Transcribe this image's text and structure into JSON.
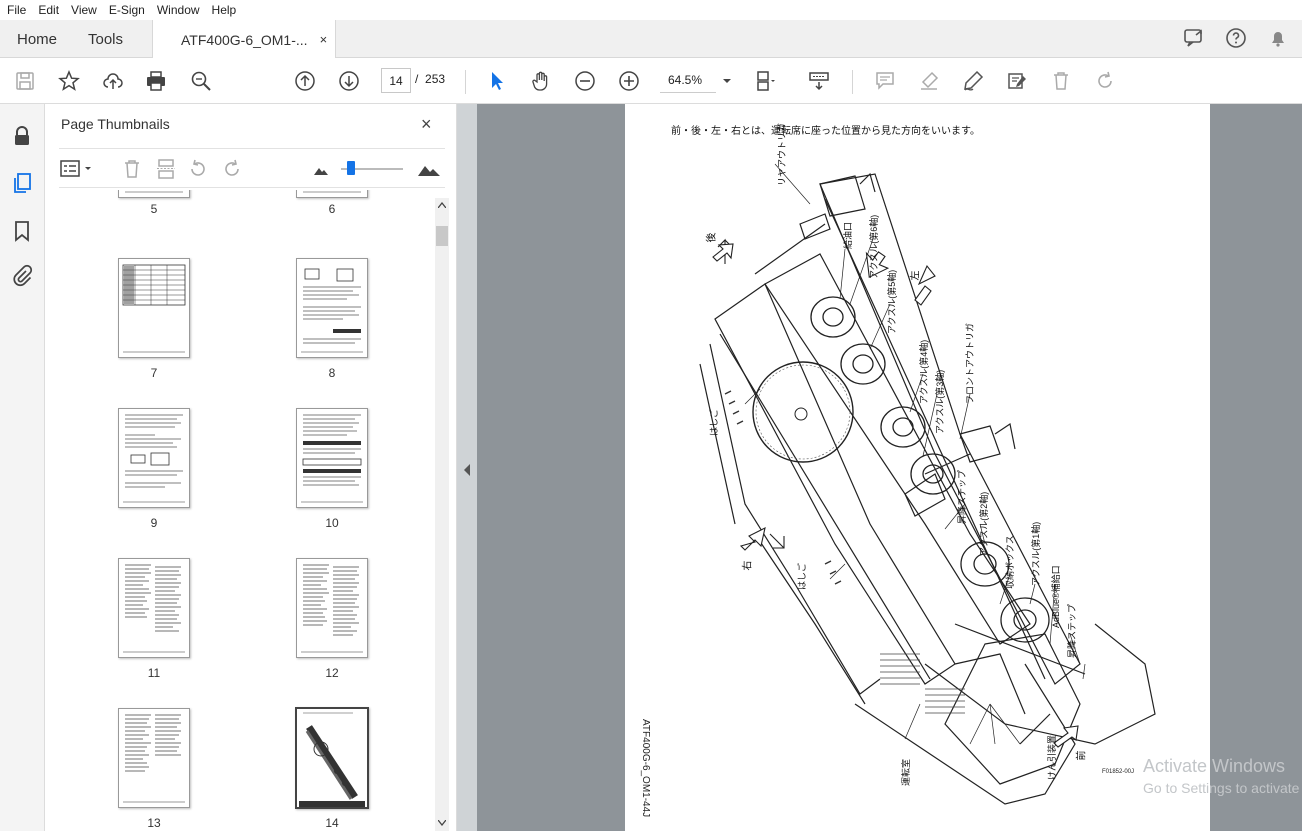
{
  "menu": [
    "File",
    "Edit",
    "View",
    "E-Sign",
    "Window",
    "Help"
  ],
  "tabs": {
    "home": "Home",
    "tools": "Tools",
    "document": "ATF400G-6_OM1-...",
    "close": "×"
  },
  "toolbar": {
    "current_page": "14",
    "page_sep": "/",
    "total_pages": "253",
    "zoom": "64.5%"
  },
  "panel": {
    "title": "Page Thumbnails",
    "close": "×"
  },
  "thumbnails": [
    {
      "label": "5"
    },
    {
      "label": "6"
    },
    {
      "label": "7"
    },
    {
      "label": "8"
    },
    {
      "label": "9"
    },
    {
      "label": "10"
    },
    {
      "label": "11"
    },
    {
      "label": "12"
    },
    {
      "label": "13"
    },
    {
      "label": "14",
      "selected": true
    }
  ],
  "document_page": {
    "header": "前・後・左・右とは、運転席に座った位置から見た方向をいいます。",
    "side_text": "ATF400G-6_OM1-44J",
    "figure_code": "F01852-00J",
    "labels": {
      "rear_outrigger": "リヤアウトリガ",
      "fuel_port": "給油口",
      "axle6": "アクスル(第6軸)",
      "axle5": "アクスル(第5軸)",
      "axle4": "アクスル(第4軸)",
      "axle3": "アクスル(第3軸)",
      "front_outrigger": "フロントアウトリガ",
      "ladder1": "はしご",
      "ladder2": "はしご",
      "step1": "昇降ステップ",
      "axle2": "アクスル(第2軸)",
      "storage_box": "収納ボックス",
      "axle1": "アクスル(第1軸)",
      "adblue": "AdBlue®補給口",
      "step2": "昇降ステップ",
      "cab": "運転室",
      "tow": "けん引装置"
    },
    "directions": {
      "rear": "後",
      "left": "左",
      "right": "右",
      "front": "前"
    }
  },
  "watermark": {
    "line1": "Activate Windows",
    "line2": "Go to Settings to activate"
  }
}
